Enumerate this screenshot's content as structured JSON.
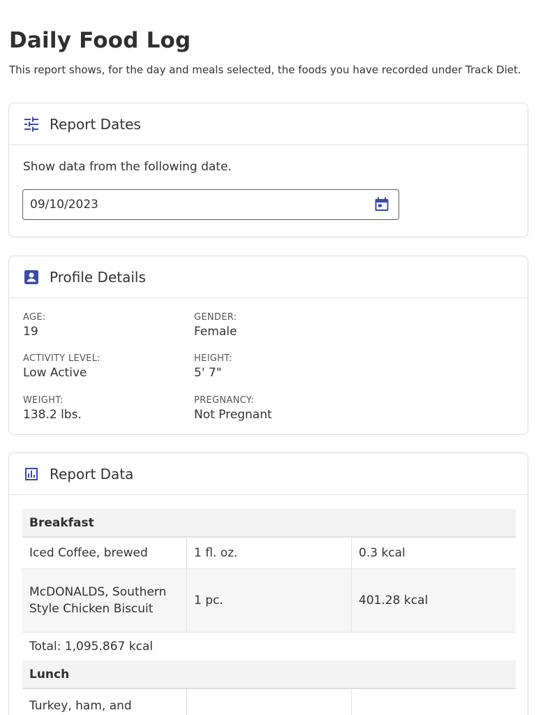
{
  "page": {
    "title": "Daily Food Log",
    "description": "This report shows, for the day and meals selected, the foods you have recorded under Track Diet."
  },
  "report_dates": {
    "title": "Report Dates",
    "icon": "sliders-icon",
    "label": "Show data from the following date.",
    "date_value": "09/10/2023",
    "calendar_icon": "calendar-icon"
  },
  "profile": {
    "title": "Profile Details",
    "icon": "profile-badge-icon",
    "age": {
      "label": "AGE:",
      "value": "19"
    },
    "gender": {
      "label": "GENDER:",
      "value": "Female"
    },
    "activity": {
      "label": "ACTIVITY LEVEL:",
      "value": "Low Active"
    },
    "height": {
      "label": "HEIGHT:",
      "value": "5' 7\""
    },
    "weight": {
      "label": "WEIGHT:",
      "value": "138.2 lbs."
    },
    "pregnancy": {
      "label": "PREGNANCY:",
      "value": "Not Pregnant"
    }
  },
  "report": {
    "title": "Report Data",
    "icon": "bar-chart-icon",
    "meals": [
      {
        "name": "Breakfast",
        "foods": [
          {
            "name": "Iced Coffee, brewed",
            "amount": "1 fl. oz.",
            "kcal": "0.3 kcal"
          },
          {
            "name": "McDONALDS, Southern Style Chicken Biscuit",
            "amount": "1 pc.",
            "kcal": "401.28 kcal"
          }
        ],
        "total": "Total: 1,095.867 kcal"
      },
      {
        "name": "Lunch",
        "foods": [
          {
            "name": "Turkey, ham, and",
            "amount": "",
            "kcal": ""
          }
        ]
      }
    ]
  },
  "colors": {
    "accent": "#3949ab",
    "border": "#dcdcdc",
    "table_header_bg": "#f3f3f3"
  }
}
